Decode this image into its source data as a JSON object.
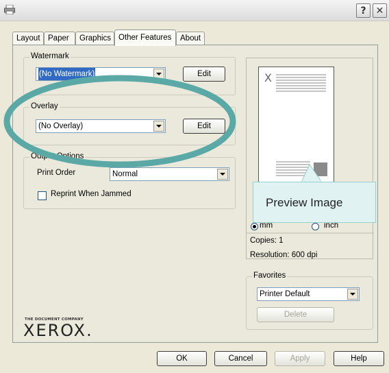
{
  "titlebar": {
    "help_label": "?",
    "close_label": "✕"
  },
  "tabs": [
    {
      "label": "Layout"
    },
    {
      "label": "Paper"
    },
    {
      "label": "Graphics"
    },
    {
      "label": "Other Features"
    },
    {
      "label": "About"
    }
  ],
  "active_tab": "Other Features",
  "watermark": {
    "legend": "Watermark",
    "value": "(No Watermark)",
    "edit_label": "Edit"
  },
  "overlay": {
    "legend": "Overlay",
    "value": "(No Overlay)",
    "edit_label": "Edit"
  },
  "output_options": {
    "legend": "Output Options",
    "print_order_label": "Print Order",
    "print_order_value": "Normal",
    "reprint_label": "Reprint When Jammed",
    "reprint_checked": false
  },
  "preview": {
    "callout": "Preview Image",
    "unit_mm": "mm",
    "unit_inch": "inch",
    "selected_unit": "mm",
    "copies": "Copies: 1",
    "resolution": "Resolution: 600 dpi",
    "paper_mark": "X"
  },
  "favorites": {
    "legend": "Favorites",
    "value": "Printer Default",
    "delete_label": "Delete"
  },
  "brand": {
    "tagline": "THE DOCUMENT COMPANY",
    "name": "XEROX."
  },
  "buttons": {
    "ok": "OK",
    "cancel": "Cancel",
    "apply": "Apply",
    "help": "Help"
  },
  "colors": {
    "highlight_ring": "#5aa9a6",
    "callout_bg": "#e0f2f2",
    "selection": "#316ac5"
  }
}
